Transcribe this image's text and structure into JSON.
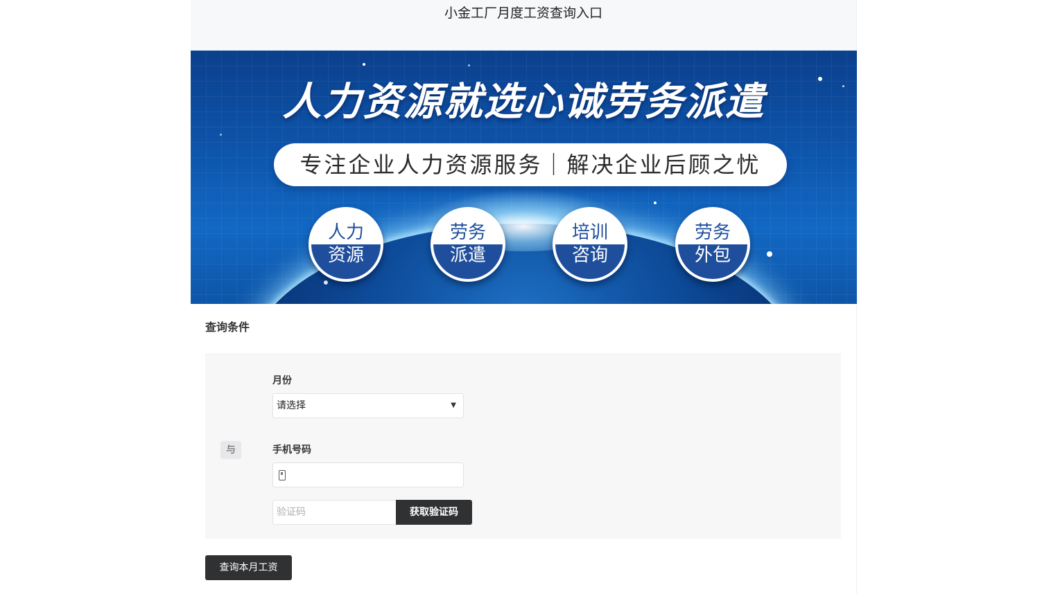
{
  "header": {
    "title": "小金工厂月度工资查询入口"
  },
  "banner": {
    "headline": "人力资源就选心诚劳务派遣",
    "slogan": "专注企业人力资源服务｜解决企业后顾之忧",
    "badges": [
      {
        "top": "人力",
        "bottom": "资源"
      },
      {
        "top": "劳务",
        "bottom": "派遣"
      },
      {
        "top": "培训",
        "bottom": "咨询"
      },
      {
        "top": "劳务",
        "bottom": "外包"
      }
    ]
  },
  "query": {
    "section_title": "查询条件",
    "and_label": "与",
    "month": {
      "label": "月份",
      "selected": "请选择"
    },
    "phone": {
      "label": "手机号码",
      "value": ""
    },
    "code": {
      "placeholder": "验证码",
      "button_label": "获取验证码"
    },
    "submit_label": "查询本月工资"
  },
  "colors": {
    "header_bg": "#f7f8fa",
    "panel_bg": "#f7f7f8",
    "button_bg": "#2f3133",
    "badge_blue": "#1f4f9c"
  }
}
